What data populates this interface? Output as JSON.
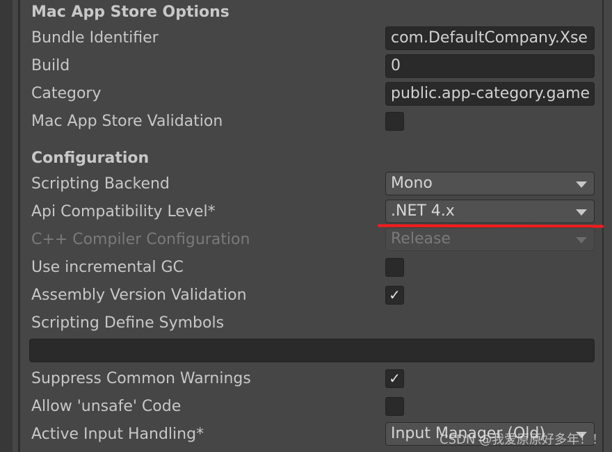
{
  "sections": {
    "mac_app_store": {
      "title": "Mac App Store Options",
      "bundle_identifier": {
        "label": "Bundle Identifier",
        "value": "com.DefaultCompany.Xse"
      },
      "build": {
        "label": "Build",
        "value": "0"
      },
      "category": {
        "label": "Category",
        "value": "public.app-category.game"
      },
      "validation": {
        "label": "Mac App Store Validation",
        "checked": false
      }
    },
    "configuration": {
      "title": "Configuration",
      "scripting_backend": {
        "label": "Scripting Backend",
        "value": "Mono"
      },
      "api_compat": {
        "label": "Api Compatibility Level*",
        "value": ".NET 4.x"
      },
      "cpp_compiler": {
        "label": "C++ Compiler Configuration",
        "value": "Release",
        "disabled": true
      },
      "incremental_gc": {
        "label": "Use incremental GC",
        "checked": false
      },
      "assembly_validation": {
        "label": "Assembly Version Validation",
        "checked": true
      },
      "define_symbols": {
        "label": "Scripting Define Symbols",
        "value": ""
      },
      "suppress_warnings": {
        "label": "Suppress Common Warnings",
        "checked": true
      },
      "allow_unsafe": {
        "label": "Allow 'unsafe' Code",
        "checked": false
      },
      "input_handling": {
        "label": "Active Input Handling*",
        "value": "Input Manager (Old)"
      }
    }
  },
  "check_glyph": "✓",
  "annotation_color": "#ff1a1a",
  "watermark": "CSDN @我爱原原好多年！！"
}
